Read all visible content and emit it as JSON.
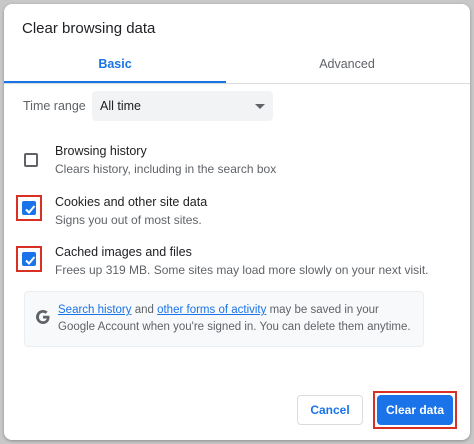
{
  "dialog": {
    "title": "Clear browsing data"
  },
  "tabs": [
    {
      "label": "Basic",
      "active": true
    },
    {
      "label": "Advanced",
      "active": false
    }
  ],
  "time_range": {
    "label": "Time range",
    "value": "All time"
  },
  "options": [
    {
      "title": "Browsing history",
      "description": "Clears history, including in the search box",
      "checked": false,
      "highlighted": false
    },
    {
      "title": "Cookies and other site data",
      "description": "Signs you out of most sites.",
      "checked": true,
      "highlighted": true
    },
    {
      "title": "Cached images and files",
      "description": "Frees up 319 MB. Some sites may load more slowly on your next visit.",
      "checked": true,
      "highlighted": true
    }
  ],
  "info": {
    "link1": "Search history",
    "text1": " and ",
    "link2": "other forms of activity",
    "text2": " may be saved in your Google Account when you're signed in. You can delete them anytime."
  },
  "buttons": {
    "cancel": "Cancel",
    "clear": "Clear data"
  },
  "colors": {
    "accent": "#1a73e8",
    "highlight": "#d93025"
  }
}
